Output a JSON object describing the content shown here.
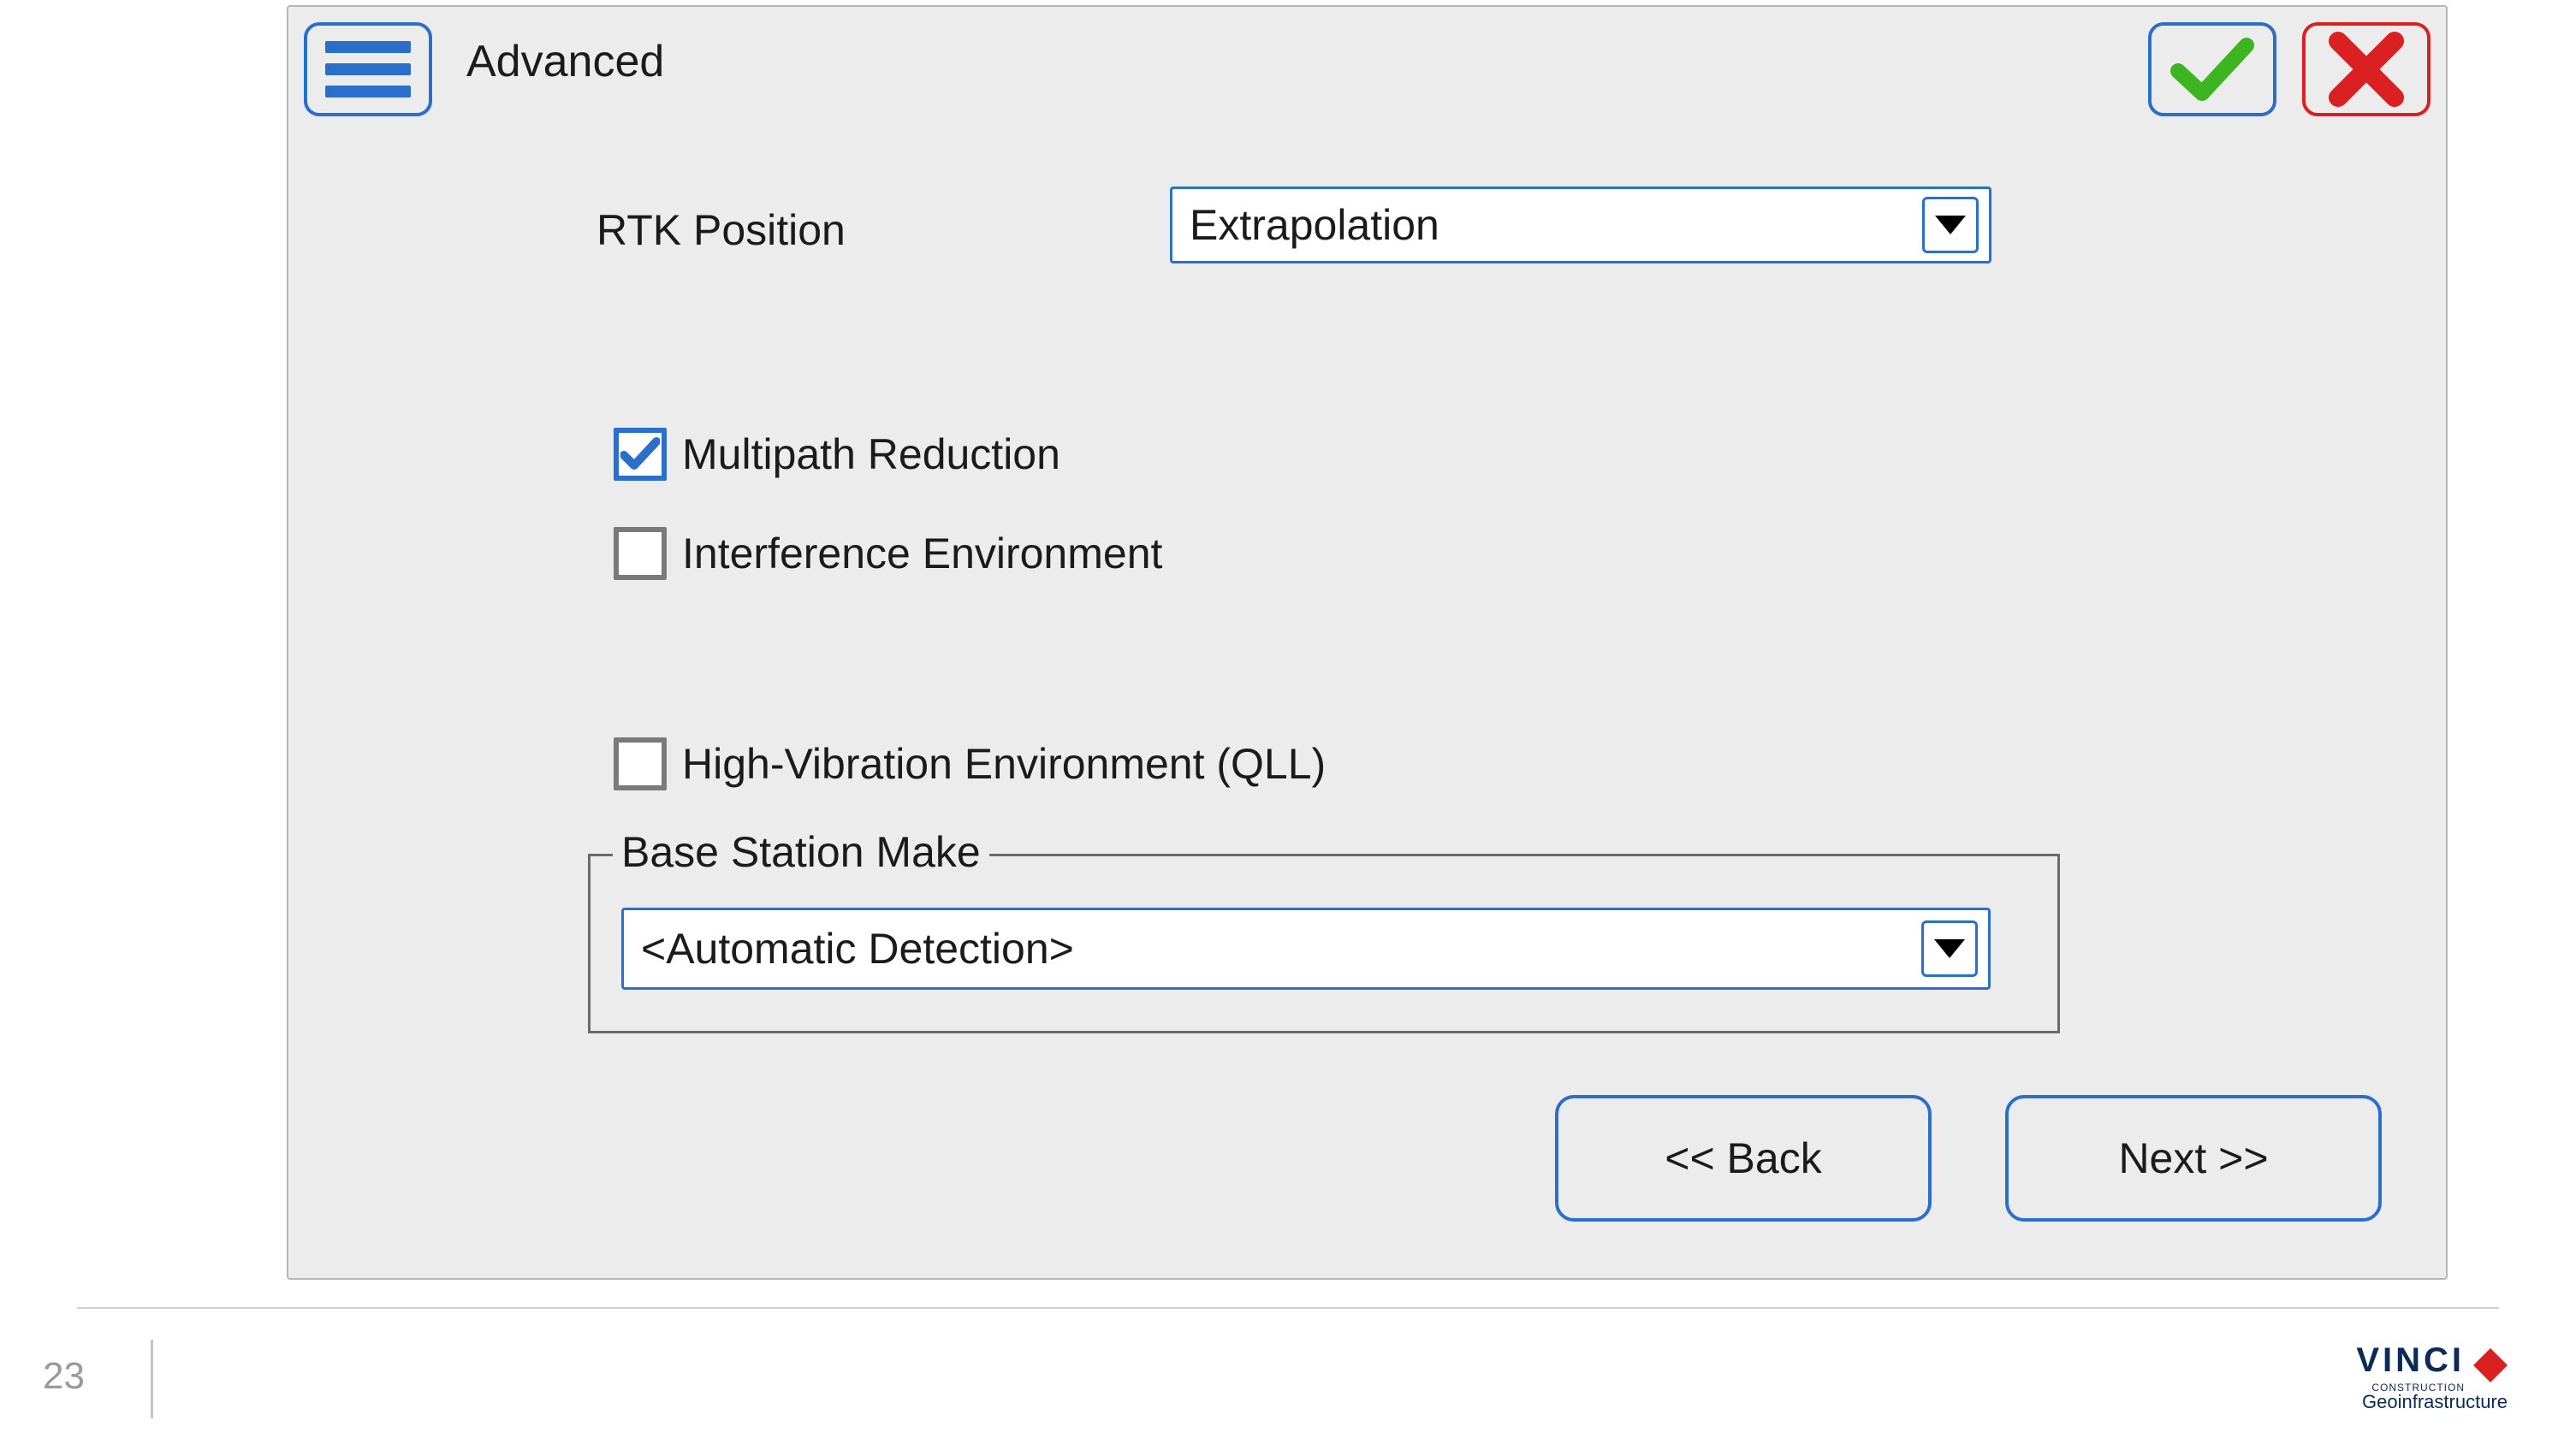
{
  "header": {
    "title": "Advanced"
  },
  "form": {
    "rtk_position_label": "RTK Position",
    "rtk_position_value": "Extrapolation",
    "multipath_reduction_label": "Multipath Reduction",
    "multipath_reduction_checked": true,
    "interference_env_label": "Interference Environment",
    "interference_env_checked": false,
    "high_vibration_label": "High-Vibration Environment (QLL)",
    "high_vibration_checked": false,
    "base_station_make_legend": "Base Station Make",
    "base_station_make_value": "<Automatic Detection>"
  },
  "nav": {
    "back_label": "<< Back",
    "next_label": "Next >>"
  },
  "footer": {
    "page_number": "23",
    "logo_primary": "VINCI",
    "logo_tagline": "CONSTRUCTION",
    "logo_division": "Geoinfrastructure"
  },
  "colors": {
    "accent": "#2a6fc9",
    "danger": "#da2020",
    "success": "#3cb521",
    "panel_bg": "#ececec"
  }
}
